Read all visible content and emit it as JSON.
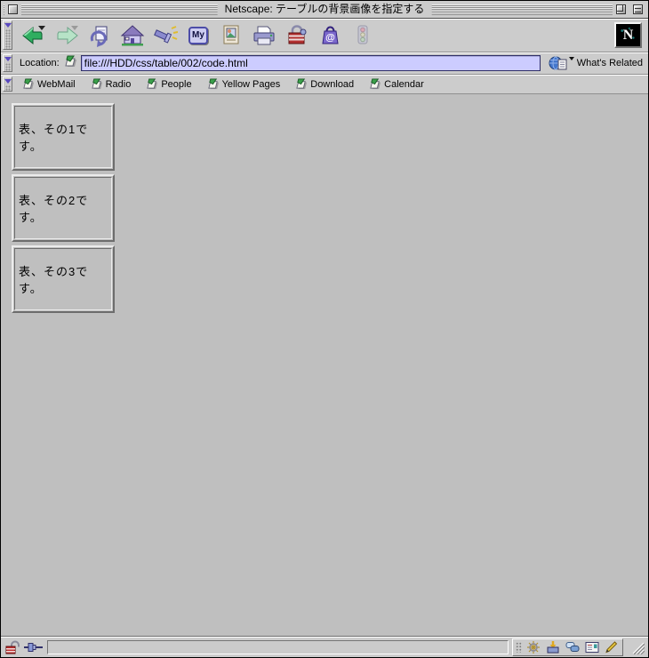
{
  "window": {
    "title": "Netscape: テーブルの背景画像を指定する",
    "logo_letter": "N"
  },
  "command_toolbar": {
    "icons": [
      "back",
      "forward",
      "reload",
      "home",
      "search",
      "my-netscape",
      "images",
      "print",
      "security",
      "shop",
      "stop"
    ],
    "my_label": "My",
    "shop_glyph": "@"
  },
  "location_bar": {
    "label": "Location:",
    "url": "file:///HDD/css/table/002/code.html",
    "whats_related_label": "What's Related"
  },
  "personal_toolbar": {
    "items": [
      {
        "label": "WebMail"
      },
      {
        "label": "Radio"
      },
      {
        "label": "People"
      },
      {
        "label": "Yellow Pages"
      },
      {
        "label": "Download"
      },
      {
        "label": "Calendar"
      }
    ]
  },
  "content": {
    "tables": [
      {
        "text": "表、その1です。"
      },
      {
        "text": "表、その2です。"
      },
      {
        "text": "表、その3です。"
      }
    ]
  },
  "status_bar": {
    "status_text": ""
  },
  "colors": {
    "toolbar_gray": "#cccccc",
    "content_gray": "#bfbfbf",
    "url_field_bg": "#ccccff",
    "accent_green": "#2fae60",
    "accent_purple": "#7777cc"
  }
}
